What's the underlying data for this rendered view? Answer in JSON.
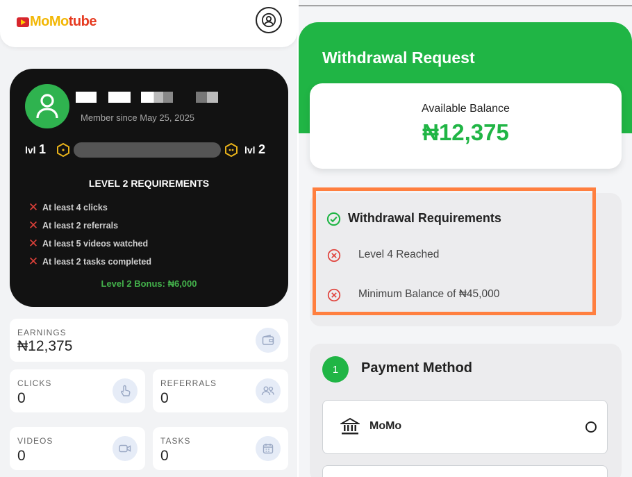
{
  "app": {
    "logo_part1": "MoMo",
    "logo_part2": "tube"
  },
  "profile": {
    "member_since": "Member since May 25, 2025",
    "level_current_label": "lvl",
    "level_current_num": "1",
    "level_next_label": "lvl",
    "level_next_num": "2",
    "level_progress": 0
  },
  "requirements": {
    "title": "LEVEL 2 REQUIREMENTS",
    "items": [
      {
        "status": "unmet",
        "label": "At least 4 clicks"
      },
      {
        "status": "unmet",
        "label": "At least 2 referrals"
      },
      {
        "status": "unmet",
        "label": "At least 5 videos watched"
      },
      {
        "status": "unmet",
        "label": "At least 2 tasks completed"
      }
    ],
    "bonus": "Level 2 Bonus: ₦6,000"
  },
  "stats": {
    "earnings": {
      "label": "EARNINGS",
      "value": "₦12,375",
      "icon": "wallet-icon"
    },
    "clicks": {
      "label": "CLICKS",
      "value": "0",
      "icon": "pointer-icon"
    },
    "referrals": {
      "label": "REFERRALS",
      "value": "0",
      "icon": "users-icon"
    },
    "videos": {
      "label": "VIDEOS",
      "value": "0",
      "icon": "video-icon"
    },
    "tasks": {
      "label": "TASKS",
      "value": "0",
      "icon": "calendar-icon"
    }
  },
  "withdrawal": {
    "title": "Withdrawal Request",
    "balance_label": "Available Balance",
    "balance_value": "₦12,375",
    "requirements_title": "Withdrawal Requirements",
    "requirements": [
      {
        "status": "unmet",
        "label": "Level 4 Reached"
      },
      {
        "status": "unmet",
        "label": "Minimum Balance of ₦45,000"
      }
    ],
    "payment_step": "1",
    "payment_title": "Payment Method",
    "payment_options": [
      {
        "label": "MoMo",
        "icon": "bank-icon",
        "selected": false
      }
    ]
  },
  "colors": {
    "brand_green": "#20b545",
    "error_red": "#e0413a",
    "highlight_orange": "#ff7f3f",
    "card_dark": "#121212",
    "level_gold": "#e8b21a"
  }
}
